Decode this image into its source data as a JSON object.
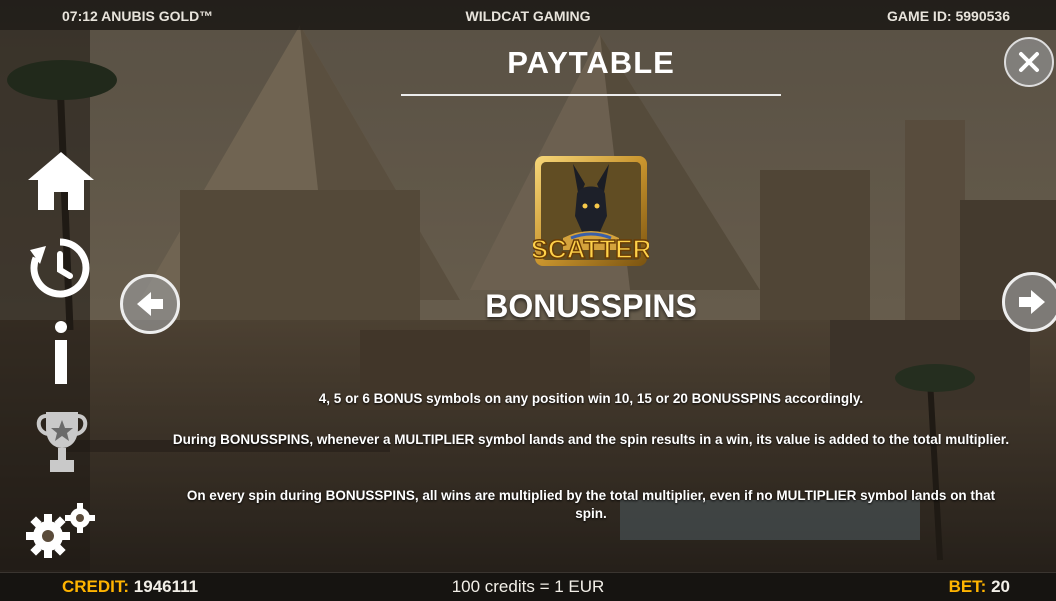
{
  "topbar": {
    "left": "07:12 ANUBIS GOLD™",
    "center": "WILDCAT GAMING",
    "right": "GAME ID: 5990536"
  },
  "paytable": {
    "title": "PAYTABLE",
    "close_icon": "close-icon",
    "symbol_label": "SCATTER",
    "section_title": "BONUSSPINS",
    "paragraphs": [
      "4, 5 or 6 BONUS symbols on any position win 10, 15 or 20 BONUSSPINS accordingly.",
      "During BONUSSPINS, whenever a MULTIPLIER symbol lands and the spin results in a win, its value is added to the total multiplier.",
      "On every spin during BONUSSPINS, all wins are multiplied by the total multiplier, even if no MULTIPLIER symbol lands on that spin."
    ]
  },
  "sidebar": {
    "icons": [
      "home-icon",
      "history-icon",
      "info-icon",
      "trophy-icon",
      "settings-icon"
    ]
  },
  "bottombar": {
    "credit_label": "CREDIT:",
    "credit_value": "1946111",
    "rate": "100 credits = 1 EUR",
    "bet_label": "BET:",
    "bet_value": "20"
  },
  "colors": {
    "accent": "#ffb400",
    "text": "#ffffff",
    "bar": "#141210"
  }
}
